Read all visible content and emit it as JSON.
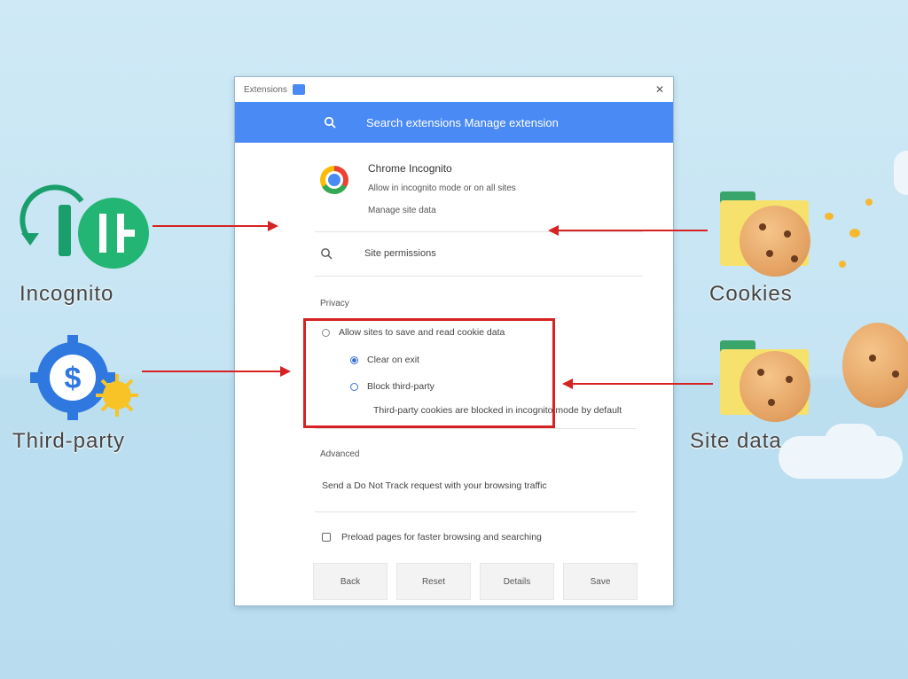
{
  "window": {
    "title": "Extensions",
    "close_glyph": "✕"
  },
  "searchbar": {
    "text": "Search extensions Manage extension"
  },
  "app": {
    "name": "Chrome Incognito",
    "subtitle": "Allow in incognito mode or on all sites",
    "note": "Manage site data"
  },
  "search_row": {
    "text": "Site permissions"
  },
  "sections": {
    "privacy_label": "Privacy",
    "options": [
      {
        "label": "Allow sites to save and read cookie data",
        "style": "empty"
      },
      {
        "label": "Clear on exit",
        "style": "filled"
      },
      {
        "label": "Block third-party",
        "style": "blue"
      }
    ],
    "options_note": "Third-party cookies are blocked in incognito mode by default",
    "advanced_label": "Advanced",
    "advanced_text": "Send a Do Not Track request with your browsing traffic",
    "checkbox_label": "Preload pages for faster browsing and searching"
  },
  "buttons": [
    "Back",
    "Reset",
    "Details",
    "Save"
  ],
  "side_labels": {
    "left_top": "Incognito",
    "left_bottom": "Third-party",
    "right_top": "Cookies",
    "right_bottom": "Site data"
  },
  "colors": {
    "accent": "#4a8af4",
    "annotation_red": "#d62222"
  }
}
